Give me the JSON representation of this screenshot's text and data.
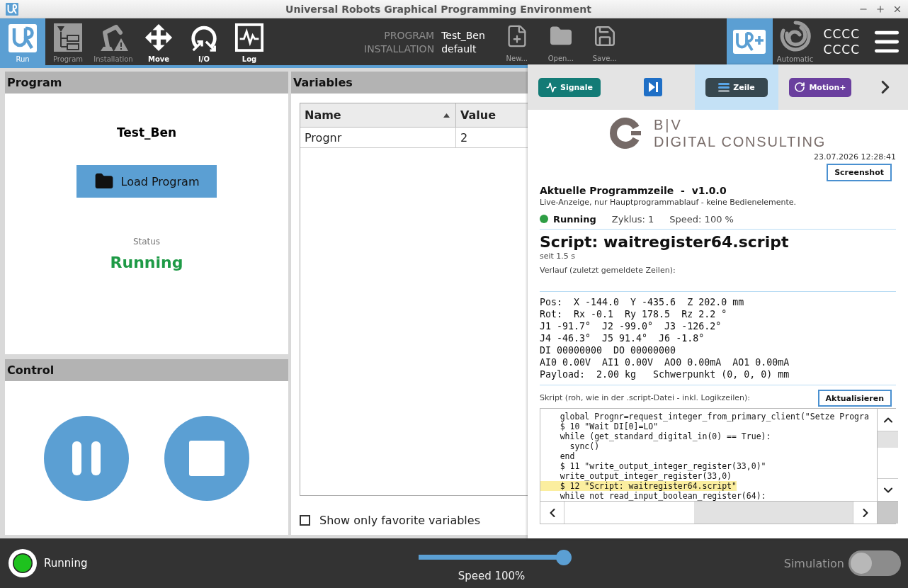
{
  "window": {
    "title": "Universal Robots Graphical Programming Environment"
  },
  "toolbar": {
    "tabs": [
      {
        "kind": "run",
        "label": "Run",
        "selected": true,
        "disabled": false
      },
      {
        "kind": "program",
        "label": "Program",
        "selected": false,
        "disabled": true
      },
      {
        "kind": "installation",
        "label": "Installation",
        "selected": false,
        "disabled": true
      },
      {
        "kind": "move",
        "label": "Move",
        "selected": false,
        "disabled": false
      },
      {
        "kind": "io",
        "label": "I/O",
        "selected": false,
        "disabled": false
      },
      {
        "kind": "log",
        "label": "Log",
        "selected": false,
        "disabled": false
      }
    ],
    "program_info": [
      {
        "label": "PROGRAM",
        "value": "Test_Ben"
      },
      {
        "label": "INSTALLATION",
        "value": "default"
      }
    ],
    "file_buttons": [
      {
        "kind": "new",
        "label": "New...",
        "disabled": true
      },
      {
        "kind": "open",
        "label": "Open...",
        "disabled": true
      },
      {
        "kind": "save",
        "label": "Save...",
        "disabled": true
      }
    ],
    "mode": {
      "label": "Automatic"
    },
    "codes": [
      "CCCC",
      "CCCC"
    ]
  },
  "program_panel": {
    "title": "Program",
    "program_name": "Test_Ben",
    "load_button": "Load Program",
    "status_label": "Status",
    "status": "Running"
  },
  "control_panel": {
    "title": "Control"
  },
  "variables_panel": {
    "title": "Variables",
    "columns": [
      {
        "label": "Name",
        "sorted": true
      },
      {
        "label": "Value",
        "sorted": false
      }
    ],
    "rows": [
      {
        "name": "Prognr",
        "value": "2"
      }
    ],
    "favorites_only": {
      "label": "Show only favorite variables",
      "checked": false
    }
  },
  "side_panel": {
    "tabs": [
      {
        "kind": "signals",
        "label": "Signale",
        "color": "#137b76",
        "selected": false
      },
      {
        "kind": "step",
        "color": "#1f6fc6",
        "selected": false
      },
      {
        "kind": "line",
        "label": "Zeile",
        "color": "#37474f",
        "selected": true
      },
      {
        "kind": "motion",
        "label": "Motion+",
        "color": "#6a3f9e",
        "selected": false
      }
    ],
    "logo": {
      "mark": "B|V",
      "name": "DIGITAL CONSULTING"
    },
    "timestamp": "23.07.2026 12:28:41",
    "screenshot_button": "Screenshot",
    "heading": "Aktuelle Programmzeile  -  v1.0.0",
    "subtitle": "Live-Anzeige, nur Hauptprogrammablauf - keine Bedienelemente.",
    "status": {
      "state": "Running",
      "running": true,
      "cycle": "Zyklus: 1",
      "speed": "Speed: 100 %"
    },
    "current_line": "Script: waitregister64.script",
    "since": "seit 1.5 s",
    "history_label": "Verlauf (zuletzt gemeldete Zeilen):",
    "readout": [
      "Pos:  X -144.0  Y -435.6  Z 202.0 mm",
      "Rot:  Rx -0.1  Ry 178.5  Rz 2.2 °",
      "J1 -91.7°  J2 -99.0°  J3 -126.2°",
      "J4 -46.3°  J5 91.4°  J6 -1.8°",
      "DI 00000000  DO 00000000",
      "AI0 0.00V  AI1 0.00V  AO0 0.00mA  AO1 0.00mA",
      "Payload:  2.00 kg   Schwerpunkt (0, 0, 0) mm"
    ],
    "script": {
      "label": "Skript (roh, wie in der .script-Datei - inkl. Logikzeilen):",
      "refresh_button": "Aktualisieren",
      "lines": [
        {
          "text": "    global Prognr=request_integer_from_primary_client(\"Setze Progra",
          "highlighted": false
        },
        {
          "text": "    $ 10 \"Wait DI[0]=LO\"",
          "highlighted": false
        },
        {
          "text": "    while (get_standard_digital_in(0) == True):",
          "highlighted": false
        },
        {
          "text": "      sync()",
          "highlighted": false
        },
        {
          "text": "    end",
          "highlighted": false
        },
        {
          "text": "    $ 11 \"write_output_integer_register(33,0)\"",
          "highlighted": false
        },
        {
          "text": "    write_output_integer_register(33,0)",
          "highlighted": false
        },
        {
          "text": "    $ 12 \"Script: waitregister64.script\"",
          "highlighted": true
        },
        {
          "text": "    while not read_input_boolean_register(64):",
          "highlighted": false
        }
      ]
    }
  },
  "bottom_bar": {
    "status": "Running",
    "running": true,
    "speed": {
      "label": "Speed 100%",
      "level": 1
    },
    "simulation": {
      "label": "Simulation",
      "on": false
    }
  }
}
